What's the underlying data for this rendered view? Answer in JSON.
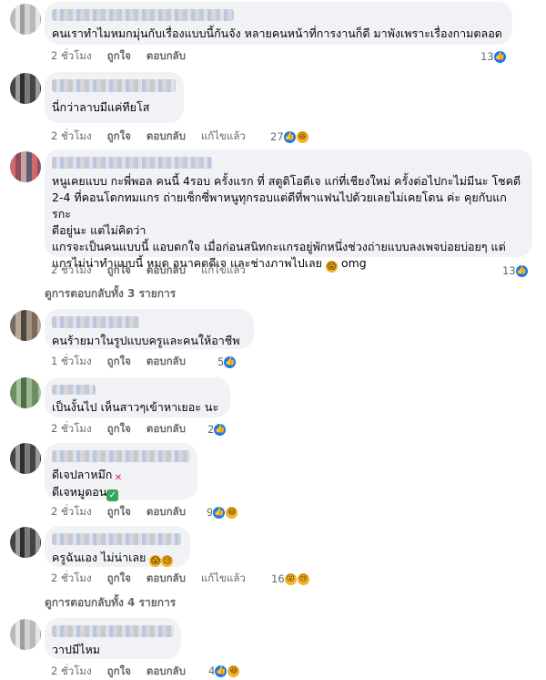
{
  "actions": {
    "like": "ถูกใจ",
    "reply": "ตอบกลับ",
    "edited": "แก้ไขแล้ว"
  },
  "icons": {
    "like": "like-thumb-icon",
    "haha": "haha-face-icon",
    "wow": "wow-face-icon",
    "sad": "sad-face-icon",
    "cross": "red-cross-emoji",
    "check": "green-check-emoji",
    "scream": "scream-face-emoji"
  },
  "colors": {
    "bubble": "#f0f2f5",
    "meta": "#65676b",
    "like": "#1877f2",
    "emoji": "#f7b125"
  },
  "comments": [
    {
      "text": "คนเราทำไมหมกมุ่นกับเรื่องแบบนี้กันจัง หลายคนหน้าที่การงานก็ดี มาพังเพราะเรื่องกามตลอด",
      "time": "2 ชั่วโมง",
      "reactions": "13"
    },
    {
      "text": "นี่กว่าลาบมีแค่ทียโส",
      "time": "2 ชั่วโมง",
      "reactions": "27"
    },
    {
      "lines": [
        "หนูเคยแบบ กะพี่พอล คนนี้ 4รอบ ครั้งแรก ที่ สตูดิโอดีเจ แก่ที่เชียงใหม่ ครั้งต่อไปกะไม่มีนะ โชคดี",
        "2-4 ที่คอนโดกทมแกร ถ่ายเซ็กซี่พาหนูทุกรอบแต่ดีที่พาแฟนไปด้วยเลยไม่เคยโดน ค่ะ คุยกับแกรกะ",
        "ดีอยู่นะ แต่ไม่คิดว่า",
        "แกรจะเป็นคนแบบนี้ แอบตกใจ เมื่อก่อนสนิทกะแกรอยู่พักหนึ่งช่วงถ่ายแบบลงเพจบ่อยบ่อยๆ แต่",
        "แกรไม่น่าทำแบบนี้ หมด อนาคตดีเจ และช่างภาพไปเลย"
      ],
      "text_end": "omg",
      "time": "2 ชั่วโมง",
      "reactions": "13",
      "view_replies": "ดูการตอบกลับทั้ง 3 รายการ"
    },
    {
      "text": "คนร้ายมาในรูปแบบครูและคนให้อาชีพ",
      "time": "1 ชั่วโมง",
      "reactions": "5"
    },
    {
      "text": "เป็นงั้นไป เห็นสาวๆเข้าหาเยอะ นะ",
      "time": "2 ชั่วโมง",
      "reactions": "2"
    },
    {
      "line1": "ดีเจปลาหมึก",
      "line2": "ดีเจหมูดอน",
      "time": "2 ชั่วโมง",
      "reactions": "9"
    },
    {
      "text": "ครูฉันเอง ไม่น่าเลย",
      "time": "2 ชั่วโมง",
      "reactions": "16",
      "view_replies": "ดูการตอบกลับทั้ง 4 รายการ"
    },
    {
      "text": "วาปมีไหม",
      "time": "2 ชั่วโมง",
      "reactions": "4"
    }
  ]
}
